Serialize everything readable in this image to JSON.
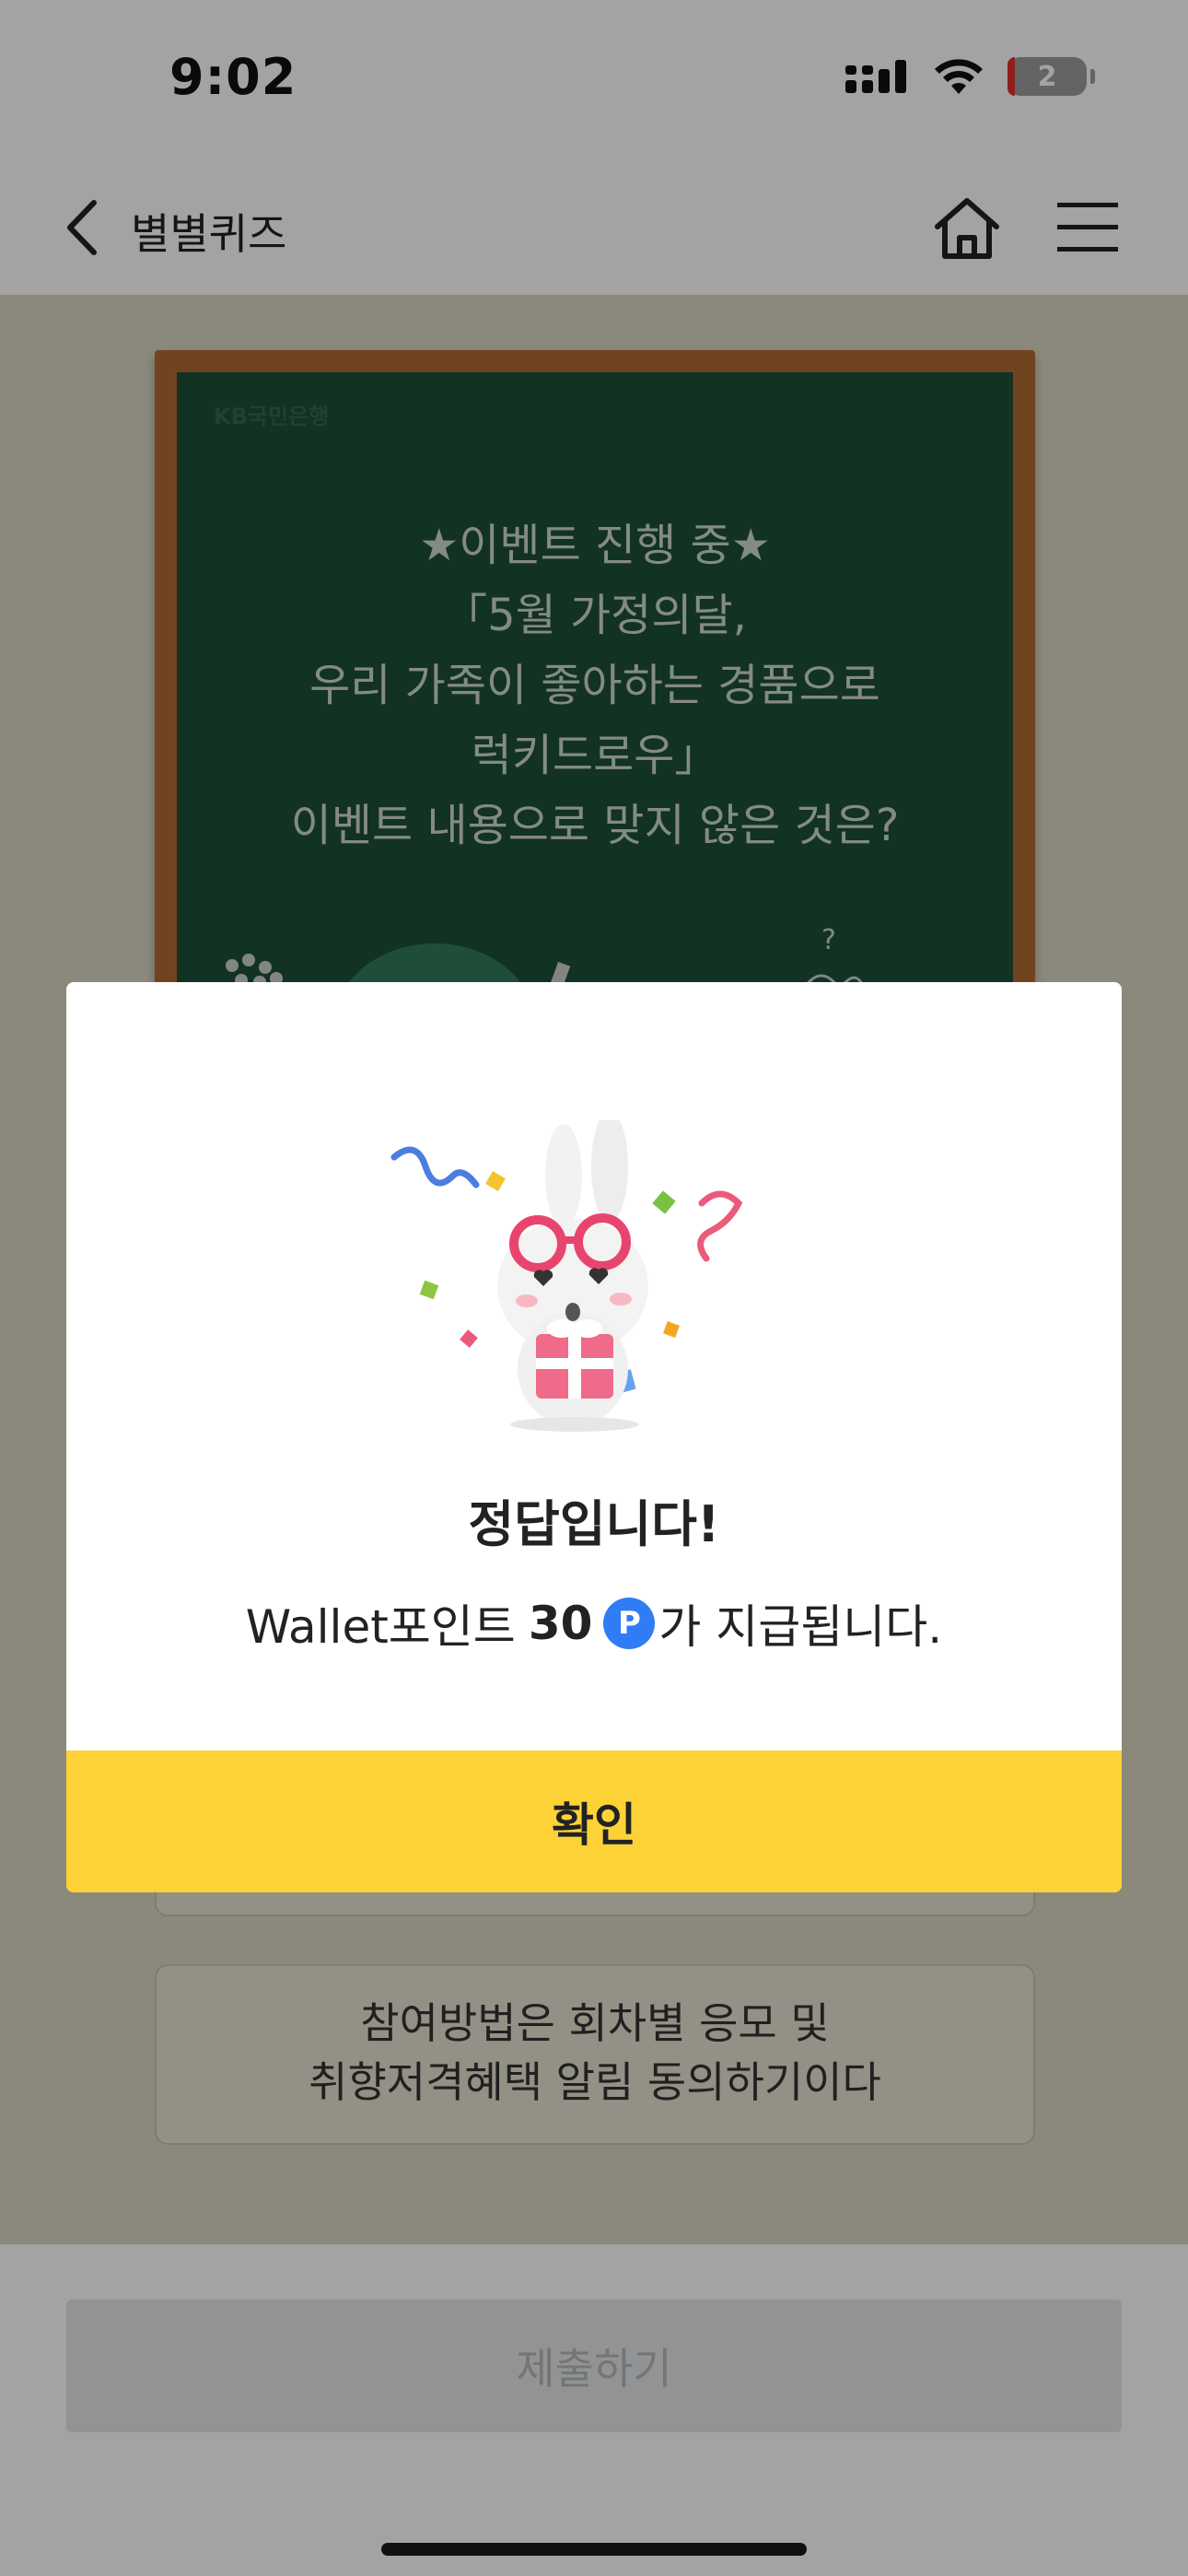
{
  "status_bar": {
    "time": "9:02",
    "battery_level": "2"
  },
  "header": {
    "title": "별별퀴즈",
    "icons": [
      "back-chevron-icon",
      "home-icon",
      "hamburger-menu-icon"
    ]
  },
  "quiz": {
    "board_logo": "KB국민은행",
    "question_lines": [
      "★이벤트 진행 중★",
      "「5월 가정의달,",
      "우리 가족이 좋아하는 경품으로",
      "럭키드로우」",
      "이벤트 내용으로 맞지 않은 것은?"
    ],
    "answer_option_2_lines": [
      "참여방법은 회차별 응모 및",
      "취향저격혜택 알림 동의하기이다"
    ]
  },
  "submit_button": {
    "label": "제출하기"
  },
  "modal": {
    "title": "정답입니다!",
    "message_prefix": "Wallet포인트",
    "points": "30",
    "point_icon_letter": "P",
    "message_suffix": "가 지급됩니다.",
    "confirm_label": "확인"
  },
  "colors": {
    "confirm_bg": "#fdd236",
    "board_green": "#1d4f37",
    "frame_wood": "#b06b35",
    "point_blue": "#2f7cf6"
  }
}
